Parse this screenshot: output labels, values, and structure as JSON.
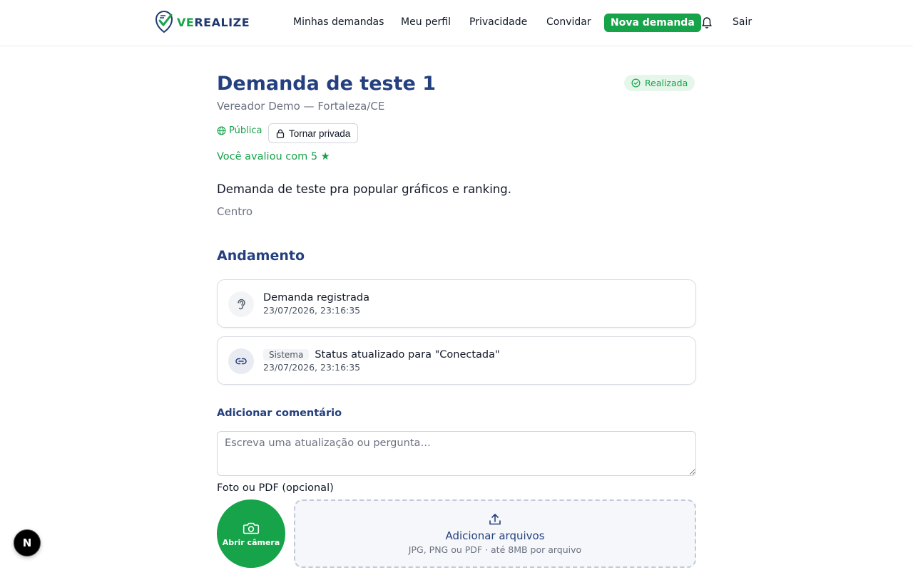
{
  "header": {
    "logo_prefix": "VE",
    "logo_rest": "REALIZE",
    "nav": [
      {
        "label": "Minhas demandas"
      },
      {
        "label": "Meu perfil"
      },
      {
        "label": "Privacidade"
      },
      {
        "label": "Convidar"
      }
    ],
    "cta_label": "Nova demanda",
    "bell_icon": "bell-icon",
    "logout_label": "Sair"
  },
  "demand": {
    "title": "Demanda de teste 1",
    "status": "Realizada",
    "subtitle": "Vereador Demo — Fortaleza/CE",
    "visibility": "Pública",
    "make_private_label": "Tornar privada",
    "rating_text": "Você avaliou com 5 ★",
    "description": "Demanda de teste pra popular gráficos e ranking.",
    "neighborhood": "Centro"
  },
  "timeline": {
    "title": "Andamento",
    "events": [
      {
        "icon": "ear-icon",
        "author": "",
        "title": "Demanda registrada",
        "time": "23/07/2026, 23:16:35"
      },
      {
        "icon": "link-icon",
        "author": "Sistema",
        "title": "Status atualizado para \"Conectada\"",
        "time": "23/07/2026, 23:16:35"
      }
    ]
  },
  "comment": {
    "label": "Adicionar comentário",
    "placeholder": "Escreva uma atualização ou pergunta…",
    "file_label": "Foto ou PDF (opcional)",
    "camera_label": "Abrir câmera",
    "dropzone_title": "Adicionar arquivos",
    "dropzone_hint": "JPG, PNG ou PDF · até 8MB por arquivo"
  },
  "dev_badge": "N",
  "colors": {
    "brand_green": "#16a34a",
    "brand_navy": "#25407f"
  }
}
